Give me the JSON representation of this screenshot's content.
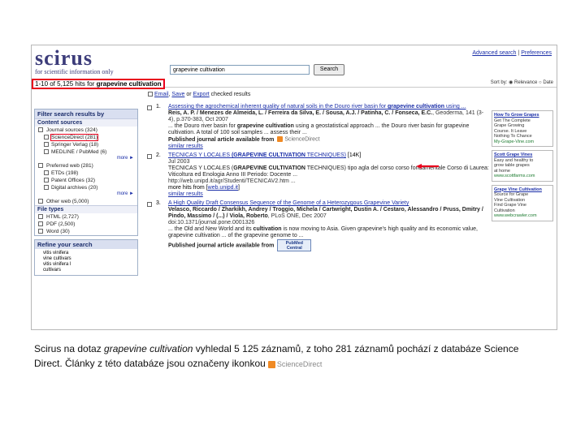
{
  "header": {
    "logo_text": "scirus",
    "logo_tagline": "for scientific information only",
    "links": [
      "Advanced search",
      "Preferences"
    ],
    "search_value": "grapevine cultivation",
    "search_button": "Search",
    "hits_prefix": "1-10 of ",
    "hits_count": "5,125",
    "hits_middle": " hits for ",
    "hits_query": "grapevine cultivation",
    "sorting": "Sort by: ◉ Relevance ○ Date"
  },
  "toolbar": {
    "email": "Email",
    "save": "Save",
    "or": " or ",
    "export": "Export",
    "rest": " checked results"
  },
  "sidebar": {
    "filter_title": "Filter search results by",
    "content_sources_title": "Content sources",
    "journal_sources": "Journal sources (324)",
    "sciencedirect": "ScienceDirect (281)",
    "springer": "Springer Verlag (18)",
    "medline": "MEDLINE / PubMed (6)",
    "more1": "more ►",
    "preferred_web": "Preferred web (281)",
    "etds": "ETDs (198)",
    "patent_offices": "Patent Offices (32)",
    "digital_archives": "Digital archives (20)",
    "more2": "more ►",
    "other_web": "Other web (5,000)",
    "file_types_title": "File types",
    "html": "HTML (2,727)",
    "pdf": "PDF (2,500)",
    "word": "Word (30)",
    "refine_title": "Refine your search",
    "refine_items": [
      "vitis vinifera",
      "vine cultivars",
      "vitis vinifera l",
      "cultivars"
    ]
  },
  "results": [
    {
      "num": "1.",
      "title_pre": "Assessing the agrochemical inherent quality of natural soils in the Douro river basin for ",
      "title_bold": "grapevine cultivation",
      "title_post": " using ...",
      "authors": "Reis, A. P. / Menezes de Almeida, L. / Ferreira da Silva, E. / Sousa, A.J. / Patinha, C. / Fonseca, E.C.",
      "meta": ", Geoderma, 141 (3-4), p.370-383, Oct 2007",
      "snippet_pre": "... the Douro river basin for ",
      "snippet_bold": "grapevine cultivation",
      "snippet_post": " using a geostatistical approach ... the Douro river basin for grapevine cultivation. A total of 100 soil samples ... assess their ...",
      "published": "Published journal article available from",
      "source_logo": "ScienceDirect",
      "similar": "similar results"
    },
    {
      "num": "2.",
      "title_pre": "TECNICAS Y LOCALES ",
      "title_bold": "(GRAPEVINE CULTIVATION",
      "title_post": " TECHNIQUES)",
      "title_extra": " [14K]",
      "meta": "Jul 2003",
      "snippet_pre": "TECNICAS Y LOCALES (",
      "snippet_bold": "GRAPEVINE CULTIVATION",
      "snippet_post": " TECHNIQUES) tipo agla del corso corso fondamentale Corso di Laurea: Viticoltura ed Enologia Anno III Periodo: Docente ...",
      "url_line": "http://web.unipd.it/agr/Studenti/TECNICAV2.htm ...",
      "more_hits": "more hits from ",
      "more_hits_link": "web.unipd.it",
      "similar": "similar results"
    },
    {
      "num": "3.",
      "title_pre": "A High Quality Draft Consensus Sequence of the Genome of a Heterozygous Grapevine Variety",
      "authors": "Velasco, Riccardo / Zharkikh, Andrey / Troggio, Michela / Cartwright, Dustin A. / Cestaro, Alessandro / Pruss, Dmitry / Pindo, Massimo / (...) / Viola, Roberto",
      "meta": ", PLoS ONE, Dec 2007",
      "doi": "doi:10.1371/journal.pone.0001326",
      "snippet_pre": "... the Old and New World and its ",
      "snippet_bold": "cultivation",
      "snippet_post": " is now moving to Asia. Given grapevine's high quality and its economic value, grapevine cultivation ... of the grapevine genome to ...",
      "published": "Published journal article available from",
      "source_logo": "PubMed Central"
    }
  ],
  "sponsored": [
    {
      "title": "How To Grow Grapes",
      "lines": [
        "Get The Complete",
        "Grape Growing",
        "Course. It Leave",
        "Nothing To Chance"
      ],
      "url": "My-Grape-Vine.com"
    },
    {
      "title": "Scott Grape Vines",
      "lines": [
        "Easy and healthy to",
        "grow table grapes",
        "at home"
      ],
      "url": "www.scottfarms.com"
    },
    {
      "title": "Grape Vine Cultivation",
      "lines": [
        "Source for Grape",
        "Vine Cultivation",
        "Find Grape Vine",
        "Cultivation"
      ],
      "url": "www.webcrawler.com"
    }
  ],
  "caption": {
    "part1": "Scirus na dotaz ",
    "query_italic": "grapevine cultivation",
    "part2": " vyhledal 5 125 záznamů, z toho 281 záznamů pochází z databáze Science",
    "part3": "Direct. Články z této databáze jsou označeny ikonkou",
    "logo_text": "ScienceDirect"
  },
  "colors": {
    "highlight_red": "#e8001c",
    "link_blue": "#1a2ea8",
    "logo_navy": "#3c3c7a"
  }
}
